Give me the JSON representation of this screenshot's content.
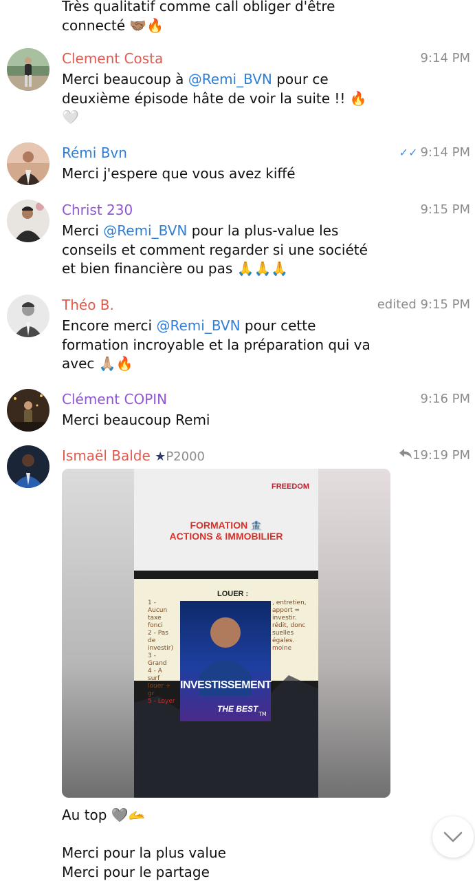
{
  "messages": [
    {
      "id": "prev",
      "text_lines": [
        "Très qualitatif comme call obliger d'être",
        "connecté 🤝🏽🔥"
      ]
    },
    {
      "id": "clement-costa",
      "sender": "Clement Costa",
      "time": "9:14 PM",
      "parts": [
        "Merci beaucoup à ",
        "@Remi_BVN",
        " pour ce",
        "deuxième épisode hâte de voir la suite !! 🔥",
        "🤍"
      ]
    },
    {
      "id": "remi-bvn",
      "sender": "Rémi Bvn",
      "time": "9:14 PM",
      "text": "Merci j'espere que vous avez kiffé"
    },
    {
      "id": "christ-230",
      "sender": "Christ 230",
      "time": "9:15 PM",
      "parts": [
        "Merci ",
        "@Remi_BVN",
        " pour la plus-value les",
        "conseils et comment regarder si une société",
        "et bien financière ou pas 🙏🙏🙏"
      ]
    },
    {
      "id": "theo-b",
      "sender": "Théo B.",
      "time": "edited 9:15 PM",
      "parts": [
        "Encore merci ",
        "@Remi_BVN",
        " pour cette",
        "formation incroyable et la préparation qui va",
        "avec 🙏🏼🔥"
      ]
    },
    {
      "id": "clement-copin",
      "sender": "Clément COPIN",
      "time": "9:16 PM",
      "text": "Merci beaucoup Remi"
    },
    {
      "id": "ismael-balde",
      "sender": "Ismaël Balde",
      "badge": "P2000",
      "replies": "1",
      "time": "9:19 PM",
      "caption_lines": [
        "Au top 🩶🫴",
        "",
        "Merci pour la plus value",
        "Merci pour le partage"
      ]
    }
  ],
  "media": {
    "brand": "FREEDOM",
    "title_line1": "FORMATION 🏦",
    "title_line2": "ACTIONS & IMMOBILIER",
    "slide_heading": "LOUER :",
    "slide_lines": [
      "1 - Aucun",
      ", entretien,",
      "taxe fonci",
      "2 - Pas de",
      "apport =",
      "investir)",
      "3 - Grand",
      "investir.",
      "4 - A surf",
      "rédit, donc",
      "louer + gr",
      "suelles",
      "égales.",
      "5 - Loyer",
      "moine"
    ],
    "poster_word": "INVESTISSEMENT",
    "poster_sub": "THE BEST",
    "poster_corner": "TM"
  },
  "colors": {
    "red": "#e05a4e",
    "blue": "#2f7fd6",
    "purple": "#9157d2",
    "time_gray": "#8c8c8c",
    "checks": "#3a8ee6"
  },
  "icons": {
    "read_receipt": "double-check-icon",
    "badge": "star-icon",
    "reply": "reply-arrow-icon",
    "scroll": "chevron-down-icon"
  }
}
